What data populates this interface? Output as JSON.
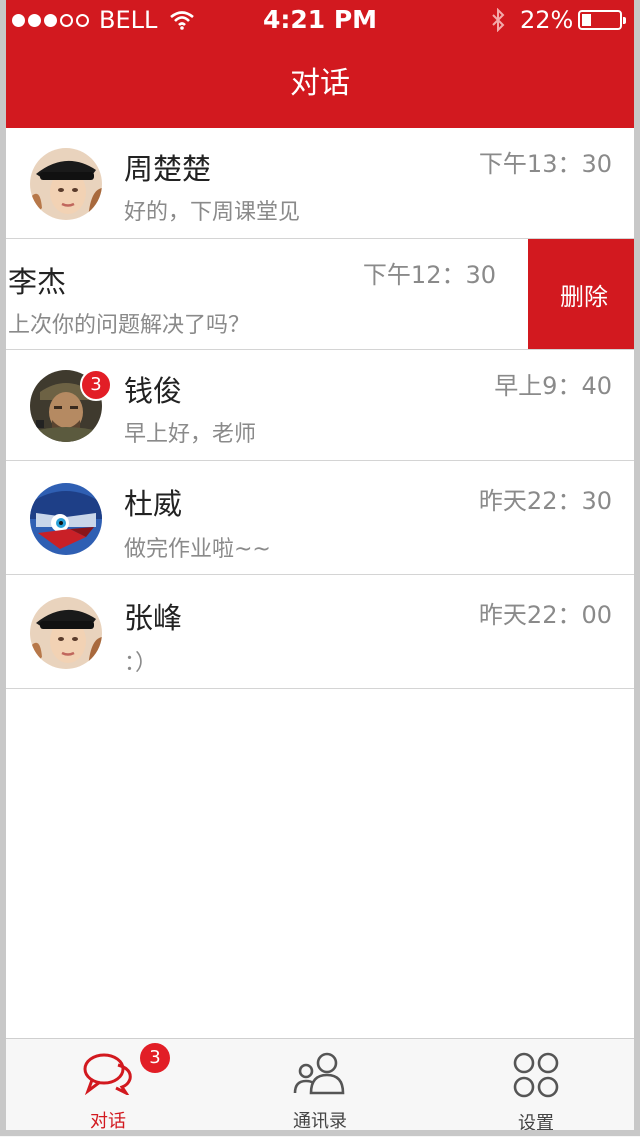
{
  "status_bar": {
    "carrier": "BELL",
    "time": "4:21 PM",
    "battery_pct": "22%"
  },
  "header": {
    "title": "对话"
  },
  "conversations": [
    {
      "name": "周楚楚",
      "message": "好的，下周课堂见",
      "time": "下午13：30"
    },
    {
      "name": "李杰",
      "message": "上次你的问题解决了吗？",
      "time": "下午12：30",
      "action": "删除"
    },
    {
      "name": "钱俊",
      "message": "早上好，老师",
      "time": "早上9：40",
      "badge": "3"
    },
    {
      "name": "杜威",
      "message": "做完作业啦~~",
      "time": "昨天22：30"
    },
    {
      "name": "张峰",
      "message": "：）",
      "time": "昨天22：00"
    }
  ],
  "tabbar": {
    "tabs": [
      {
        "label": "对话",
        "badge": "3"
      },
      {
        "label": "通讯录"
      },
      {
        "label": "设置"
      }
    ]
  },
  "colors": {
    "accent": "#d2191f",
    "badge": "#e21e26"
  },
  "icons": {
    "wifi": "wifi-icon",
    "bluetooth": "bluetooth-icon",
    "chat": "chat-icon",
    "contacts": "contacts-icon",
    "settings": "settings-icon"
  }
}
